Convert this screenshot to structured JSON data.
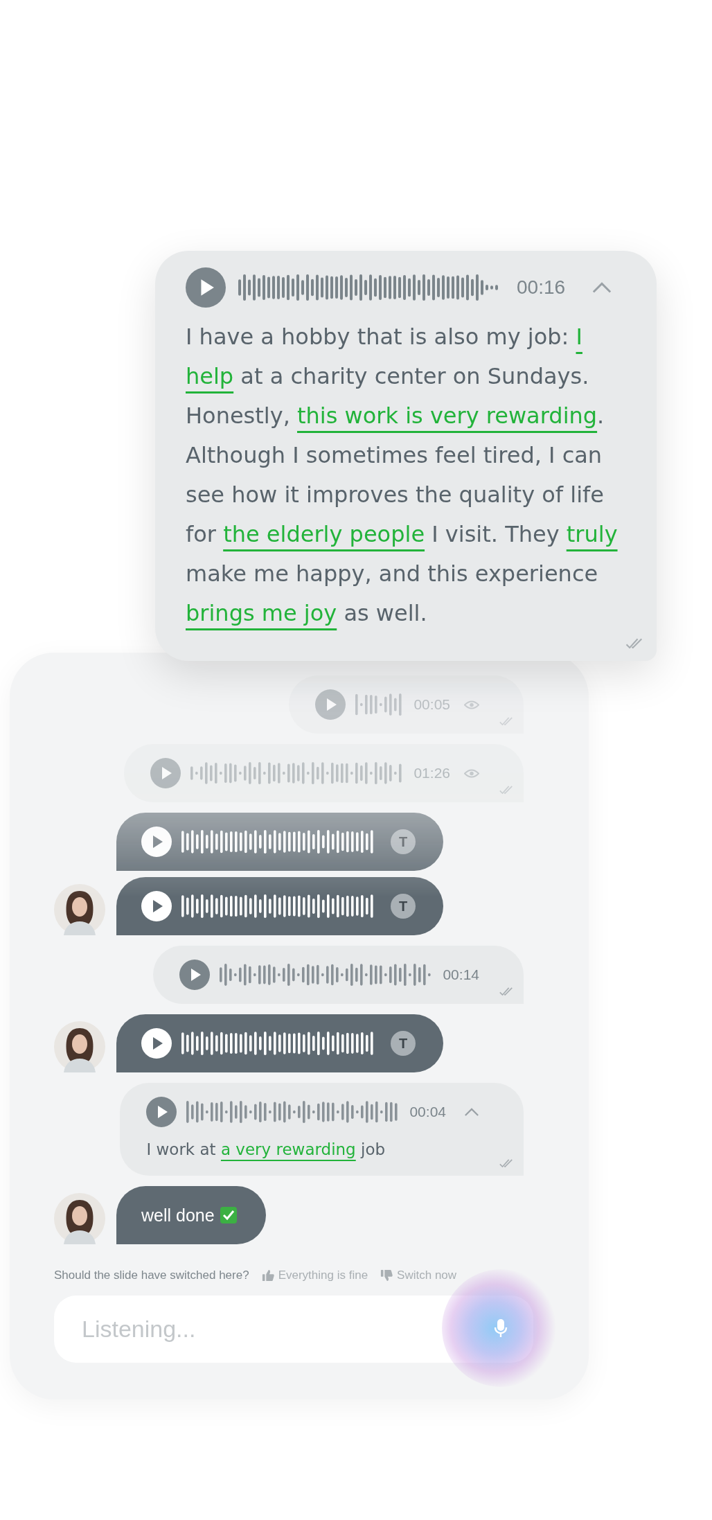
{
  "transcript_card": {
    "duration": "00:16",
    "expanded": true,
    "read": true,
    "segments": [
      {
        "text": "I have a hobby that is also my job: ",
        "highlight": false
      },
      {
        "text": "I help",
        "highlight": true
      },
      {
        "text": " at a charity center on Sundays. Honestly, ",
        "highlight": false
      },
      {
        "text": "this work is very rewarding",
        "highlight": true
      },
      {
        "text": ". Although I sometimes feel tired, I can see how it improves the quality of life for ",
        "highlight": false
      },
      {
        "text": "the elderly people",
        "highlight": true
      },
      {
        "text": " I visit. They ",
        "highlight": false
      },
      {
        "text": "truly",
        "highlight": true
      },
      {
        "text": " make me happy, and this experience ",
        "highlight": false
      },
      {
        "text": "brings me joy",
        "highlight": true
      },
      {
        "text": " as well.",
        "highlight": false
      }
    ]
  },
  "messages": [
    {
      "kind": "outgoing_voice",
      "duration": "00:05",
      "viewed": true,
      "read": true,
      "expanded": false
    },
    {
      "kind": "outgoing_voice",
      "duration": "01:26",
      "viewed": true,
      "read": true,
      "expanded": false
    },
    {
      "kind": "incoming_voice",
      "transcript_button": "T",
      "avatar": false
    },
    {
      "kind": "incoming_voice",
      "transcript_button": "T",
      "avatar": true
    },
    {
      "kind": "outgoing_voice",
      "duration": "00:14",
      "viewed": false,
      "read": true,
      "expanded": false
    },
    {
      "kind": "incoming_voice",
      "transcript_button": "T",
      "avatar": true
    },
    {
      "kind": "outgoing_voice",
      "duration": "00:04",
      "viewed": false,
      "read": true,
      "expanded": true,
      "segments": [
        {
          "text": "I work at ",
          "highlight": false
        },
        {
          "text": "a very rewarding",
          "highlight": true
        },
        {
          "text": " job",
          "highlight": false
        }
      ]
    },
    {
      "kind": "incoming_text",
      "text": "well done",
      "avatar": true
    }
  ],
  "feedback": {
    "question": "Should the slide have switched here?",
    "options": [
      {
        "kind": "like",
        "label": "Everything is fine"
      },
      {
        "kind": "dislike",
        "label": "Switch now"
      }
    ]
  },
  "input": {
    "placeholder": "Listening..."
  }
}
